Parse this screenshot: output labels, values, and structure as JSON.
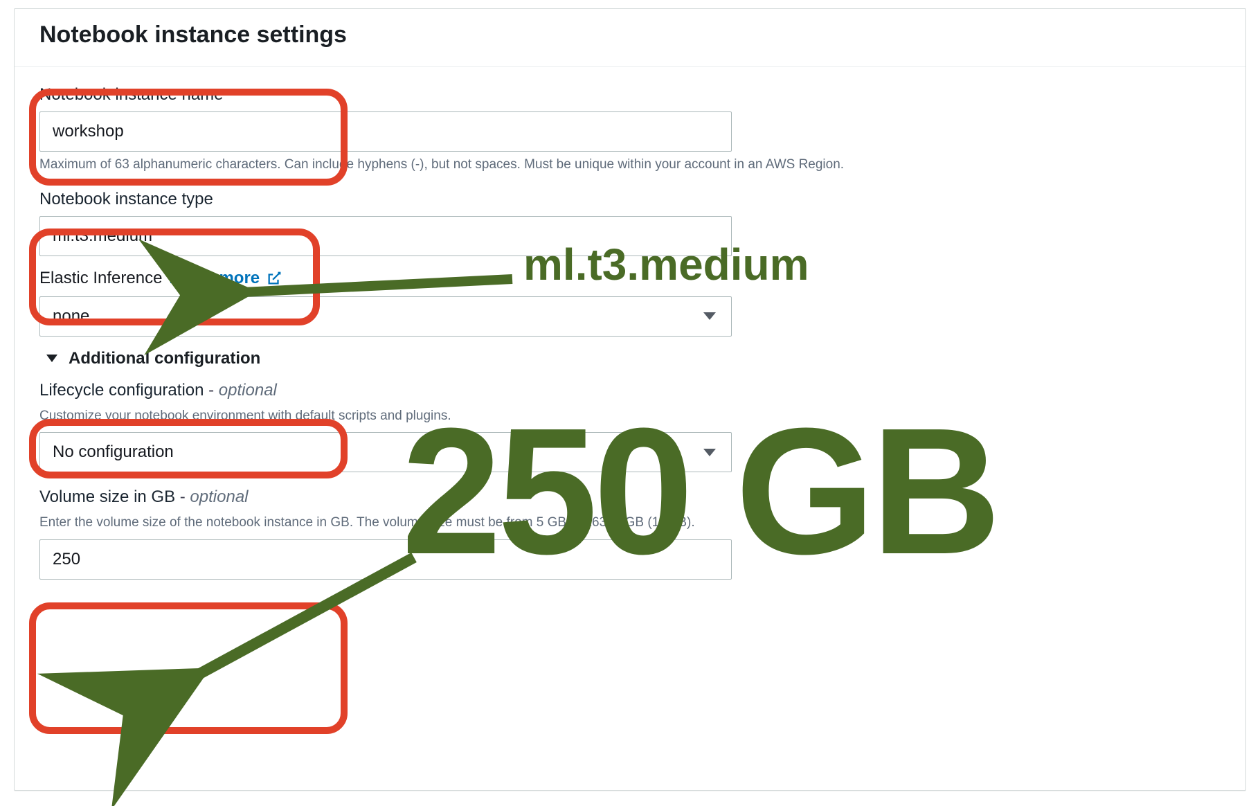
{
  "panel": {
    "title": "Notebook instance settings"
  },
  "name_field": {
    "label": "Notebook instance name",
    "value": "workshop",
    "hint": "Maximum of 63 alphanumeric characters. Can include hyphens (-), but not spaces. Must be unique within your account in an AWS Region."
  },
  "type_field": {
    "label": "Notebook instance type",
    "value": "ml.t3.medium"
  },
  "ei": {
    "label": "Elastic Inference",
    "link": "Learn more",
    "value": "none"
  },
  "addl": {
    "label": "Additional configuration"
  },
  "lifecycle": {
    "label": "Lifecycle configuration",
    "dash": " - ",
    "optional": "optional",
    "hint": "Customize your notebook environment with default scripts and plugins.",
    "value": "No configuration"
  },
  "volume": {
    "label": "Volume size in GB",
    "dash": " - ",
    "optional": "optional",
    "hint": "Enter the volume size of the notebook instance in GB. The volume size must be from 5 GB to 16384 GB (16 TB).",
    "value": "250"
  },
  "annotations": {
    "type_text": "ml.t3.medium",
    "volume_text": "250 GB"
  }
}
